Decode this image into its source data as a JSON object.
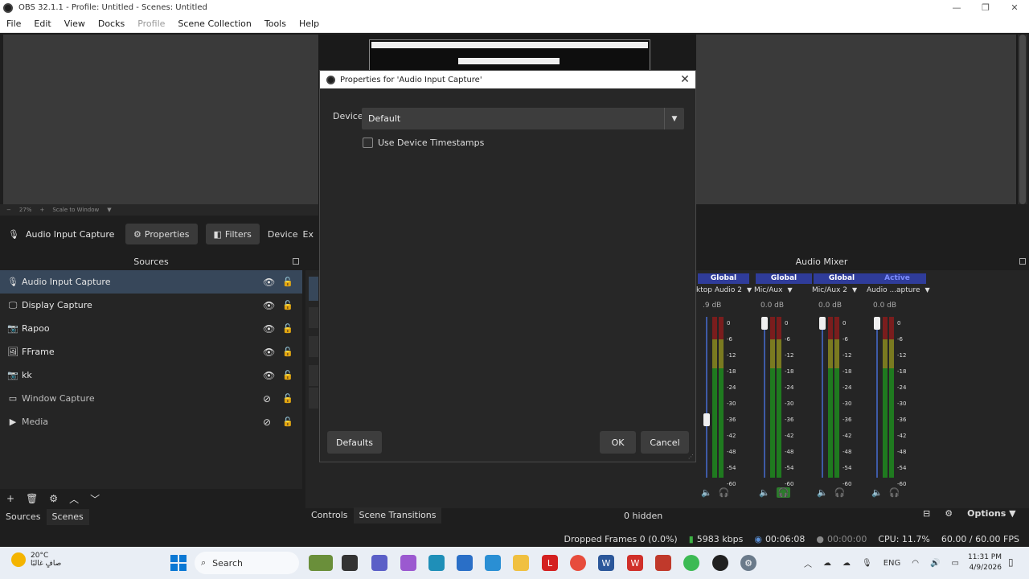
{
  "window": {
    "title": "OBS 32.1.1 - Profile: Untitled - Scenes: Untitled",
    "controls": [
      "—",
      "❐",
      "✕"
    ]
  },
  "menu": [
    "File",
    "Edit",
    "View",
    "Docks",
    "Profile",
    "Scene Collection",
    "Tools",
    "Help"
  ],
  "zoombar": {
    "zoom": "27%",
    "scale_mode": "Scale to Window"
  },
  "context_bar": {
    "source_name": "Audio Input Capture",
    "properties_label": "Properties",
    "filters_label": "Filters",
    "device_label": "Device",
    "overflow_label": "Ex"
  },
  "sources": {
    "title": "Sources",
    "items": [
      {
        "label": "Audio Input Capture",
        "icon": "mic-icon",
        "glyph": "🎙",
        "visible": true,
        "selected": true
      },
      {
        "label": "Display Capture",
        "icon": "monitor-icon",
        "glyph": "🖵",
        "visible": true,
        "selected": false
      },
      {
        "label": "Rapoo",
        "icon": "camera-icon",
        "glyph": "📷",
        "visible": true,
        "selected": false
      },
      {
        "label": "FFrame",
        "icon": "image-icon",
        "glyph": "🖼",
        "visible": true,
        "selected": false
      },
      {
        "label": "kk",
        "icon": "camera-icon",
        "glyph": "📷",
        "visible": true,
        "selected": false
      },
      {
        "label": "Window Capture",
        "icon": "window-icon",
        "glyph": "▭",
        "visible": false,
        "selected": false
      },
      {
        "label": "Media",
        "icon": "play-icon",
        "glyph": "▶",
        "visible": false,
        "selected": false
      }
    ]
  },
  "bottom_tabs": [
    "Sources",
    "Scenes"
  ],
  "mid_tabs": [
    "Controls",
    "Scene Transitions"
  ],
  "audio_mixer": {
    "title": "Audio Mixer",
    "channels": [
      {
        "tag": "Global",
        "name": "ktop Audio 2",
        "db": ".9 dB",
        "headphones_on": false
      },
      {
        "tag": "Global",
        "name": "Mic/Aux",
        "db": "0.0 dB",
        "headphones_on": true
      },
      {
        "tag": "Global",
        "name": "Mic/Aux 2",
        "db": "0.0 dB",
        "headphones_on": false
      },
      {
        "tag": "Active",
        "name": "Audio ...apture",
        "db": "0.0 dB",
        "headphones_on": false
      }
    ],
    "scale": [
      "0",
      "-6",
      "-12",
      "-18",
      "-24",
      "-30",
      "-36",
      "-42",
      "-48",
      "-54",
      "-60"
    ],
    "hidden_count": "0 hidden",
    "options_label": "Options"
  },
  "status": {
    "dropped": "Dropped Frames 0 (0.0%)",
    "bitrate": "5983 kbps",
    "rec_time": "00:06:08",
    "stream_time": "00:00:00",
    "cpu": "CPU: 11.7%",
    "fps": "60.00 / 60.00 FPS"
  },
  "dialog": {
    "title": "Properties for 'Audio Input Capture'",
    "device_label": "Device",
    "device_value": "Default",
    "timestamps_label": "Use Device Timestamps",
    "timestamps_checked": false,
    "defaults_label": "Defaults",
    "ok_label": "OK",
    "cancel_label": "Cancel"
  },
  "taskbar": {
    "temperature": "20°C",
    "weather_text": "صافٍ غالبًا",
    "search_label": "Search",
    "language": "ENG",
    "time": "11:31 PM",
    "date": "4/9/2026"
  }
}
